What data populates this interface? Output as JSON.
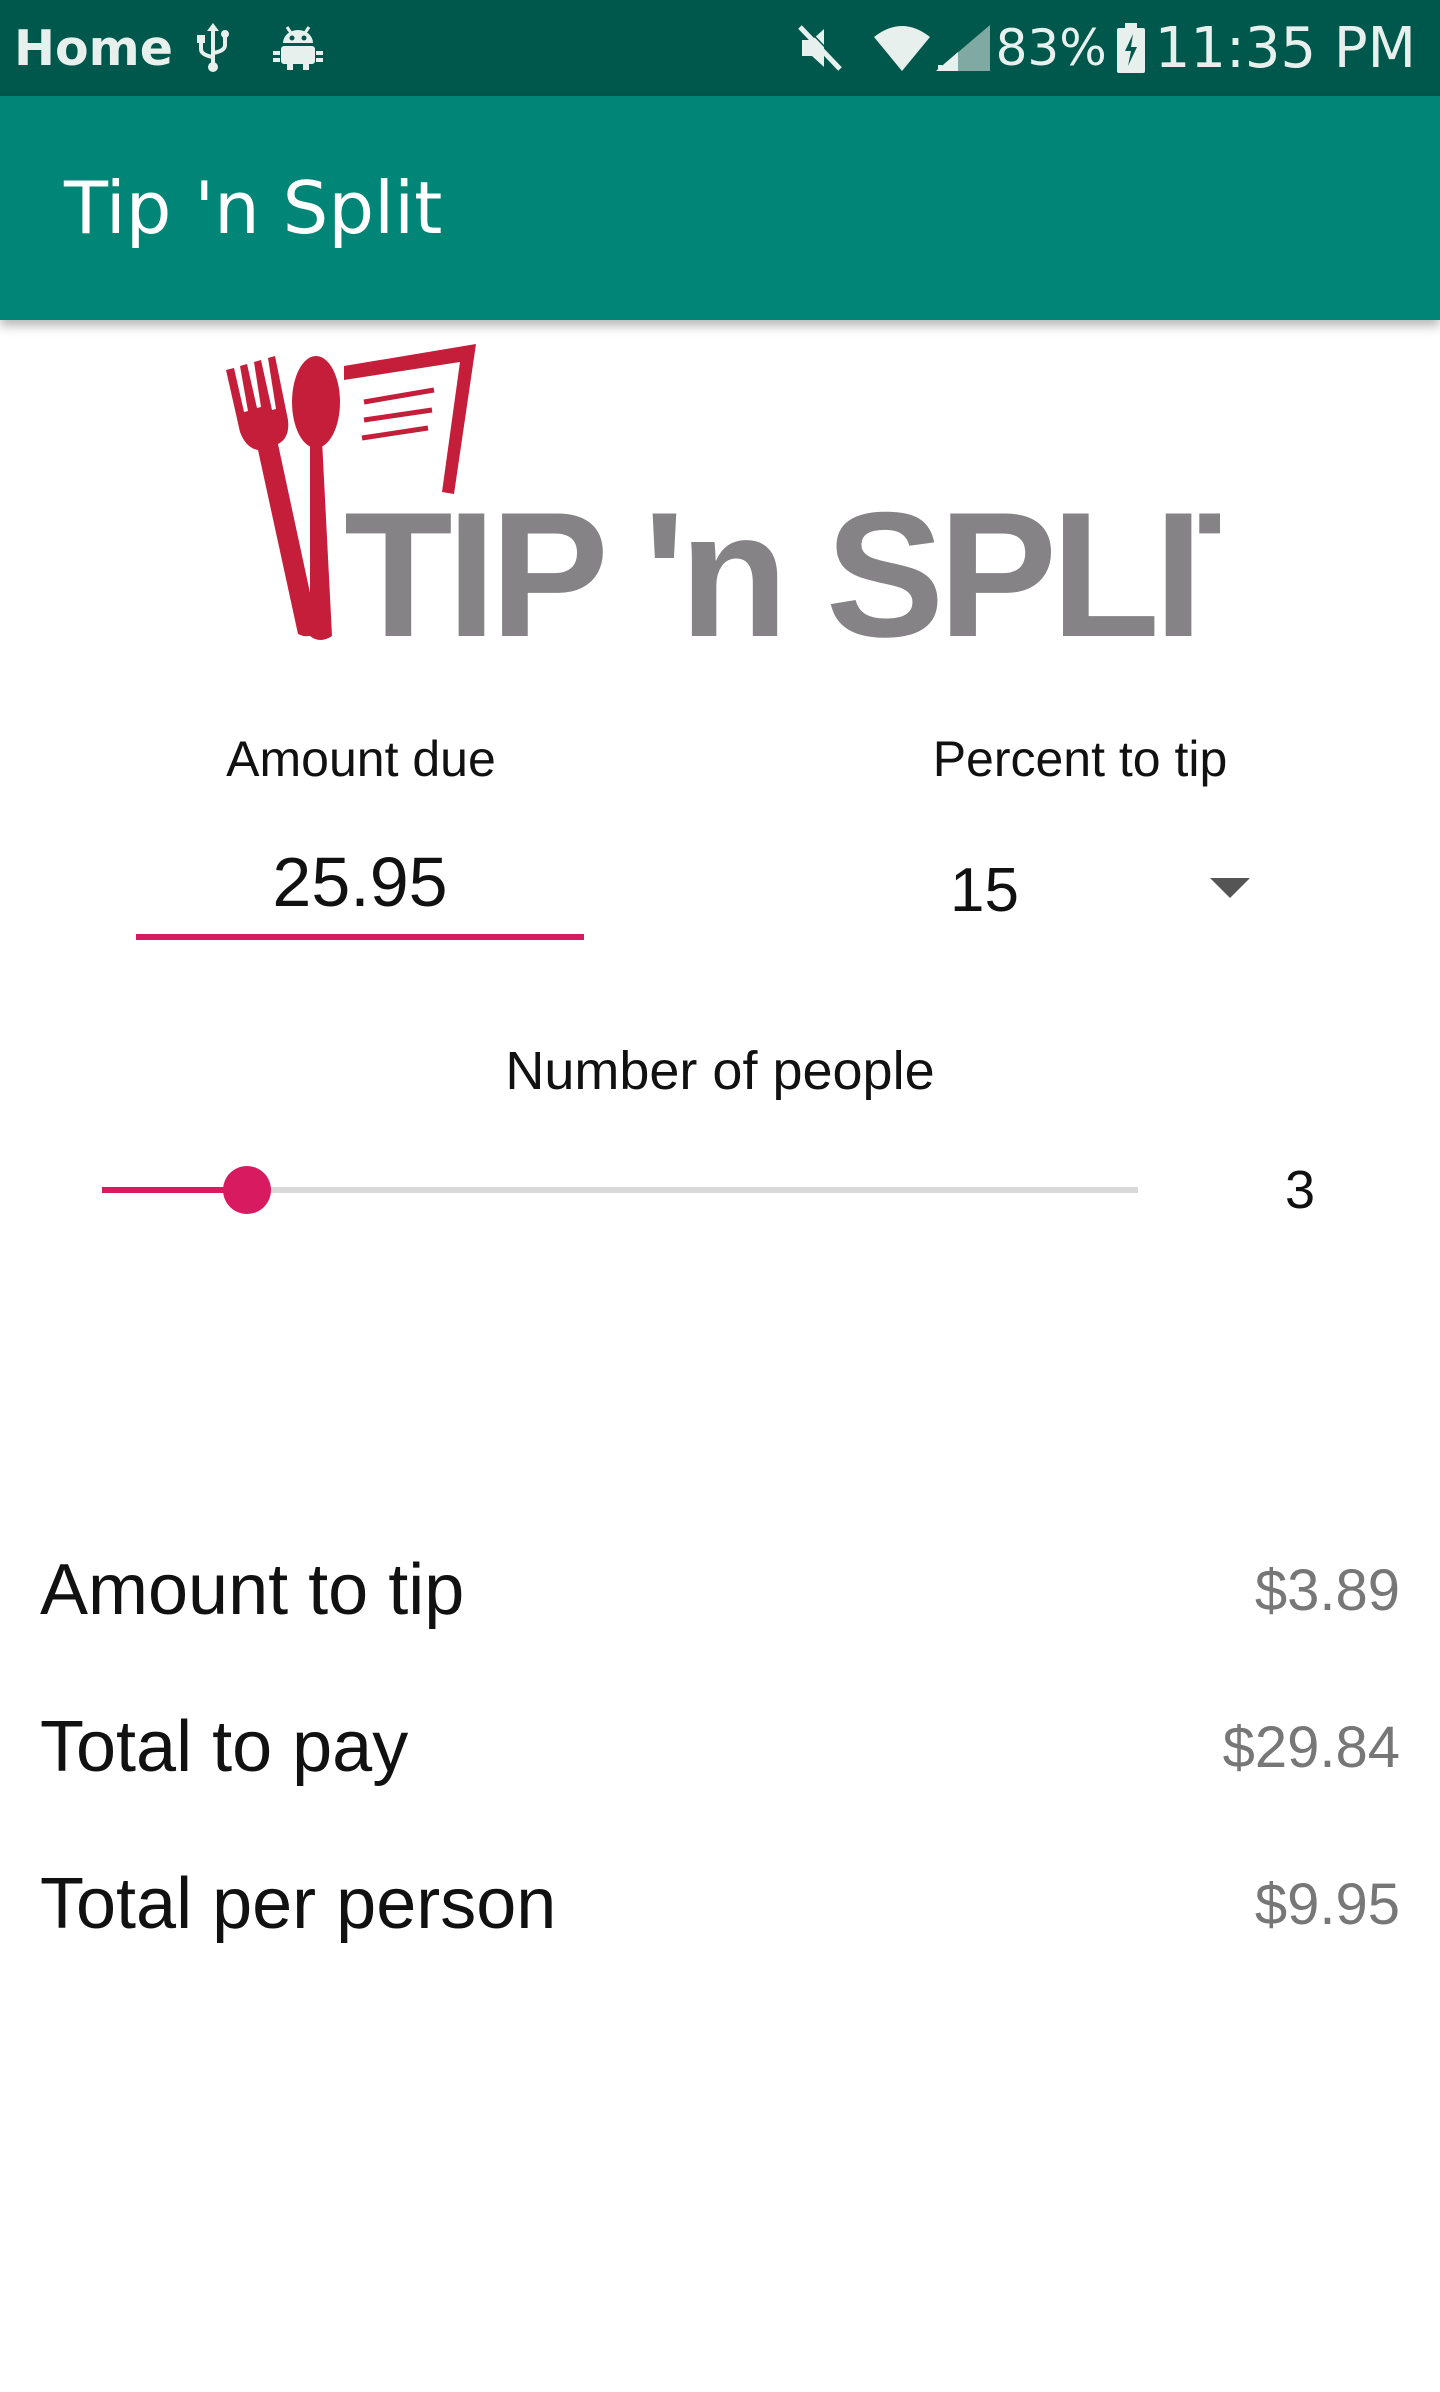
{
  "status_bar": {
    "home_label": "Home",
    "battery_percent": "83%",
    "time": "11:35 PM",
    "icons": [
      "usb-icon",
      "android-debug-icon",
      "mute-icon",
      "wifi-icon",
      "signal-icon",
      "battery-icon"
    ]
  },
  "app_bar": {
    "title": "Tip 'n Split"
  },
  "logo": {
    "text": "TIP 'n SPLIT",
    "colors": {
      "utensils": "#c41e3a",
      "text": "#858385"
    }
  },
  "form": {
    "amount_due_label": "Amount due",
    "amount_due_value": "25.95",
    "percent_label": "Percent to tip",
    "percent_value": "15",
    "people_label": "Number of people",
    "people_value": "3",
    "people_slider_fraction": 0.14
  },
  "results": {
    "tip_label": "Amount to tip",
    "tip_value": "$3.89",
    "total_label": "Total to pay",
    "total_value": "$29.84",
    "per_person_label": "Total per person",
    "per_person_value": "$9.95"
  },
  "colors": {
    "status_bar": "#00574b",
    "app_bar": "#008577",
    "accent": "#d81b60"
  }
}
